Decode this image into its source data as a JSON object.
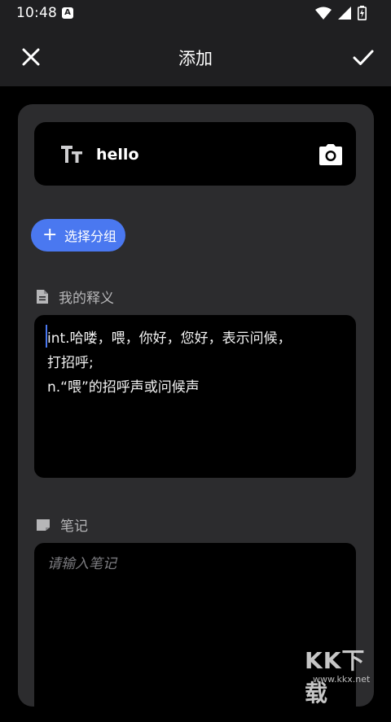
{
  "status_bar": {
    "time": "10:48",
    "notification_badge": "A",
    "icons": [
      "wifi-icon",
      "signal-icon",
      "battery-charging-icon"
    ]
  },
  "app_bar": {
    "title": "添加",
    "close_icon": "close-icon",
    "confirm_icon": "check-icon"
  },
  "word_field": {
    "value": "hello",
    "leading_icon": "text-size-icon",
    "trailing_icon": "camera-icon"
  },
  "group_button": {
    "label": "选择分组",
    "icon": "plus-icon",
    "color": "#4a78f0"
  },
  "definition_section": {
    "label": "我的释义",
    "icon": "document-icon",
    "text": "int.哈喽，喂，你好，您好，表示问候，\n打招呼;\nn.“喂”的招呼声或问候声"
  },
  "note_section": {
    "label": "笔记",
    "icon": "note-icon",
    "placeholder": "请输入笔记",
    "value": ""
  },
  "watermark": {
    "main": "KK下载",
    "sub": "www.kkx.net"
  },
  "colors": {
    "background": "#000000",
    "bar": "#1f1f21",
    "card": "#2c2c2e",
    "accent": "#4a78f0"
  }
}
